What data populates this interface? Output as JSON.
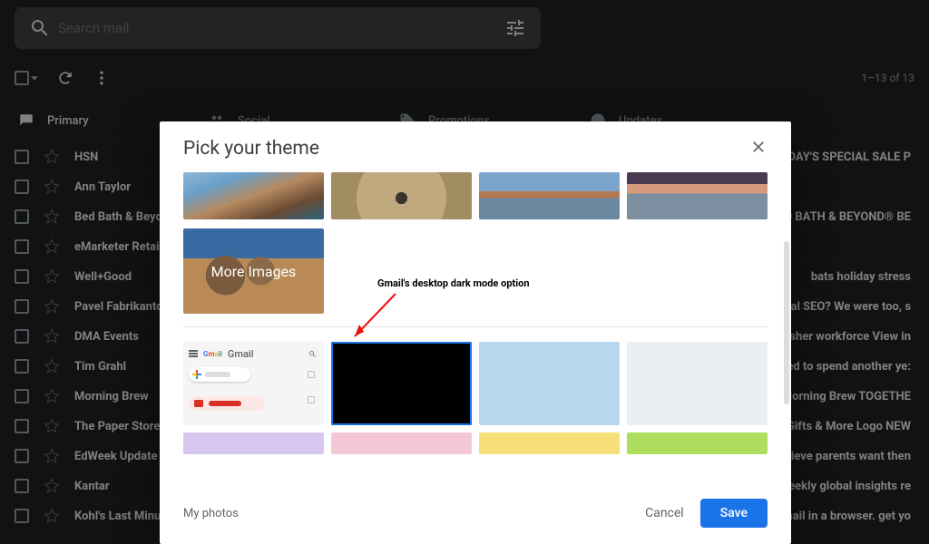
{
  "search": {
    "placeholder": "Search mail"
  },
  "toolbar": {
    "range": "1–13 of 13"
  },
  "tabs": {
    "primary": "Primary",
    "social": "Social",
    "promotions": "Promotions",
    "updates": "Updates"
  },
  "mail": [
    {
      "sender": "HSN",
      "snippet": "SN TODAY'S SPECIAL SALE P"
    },
    {
      "sender": "Ann Taylor",
      "snippet": ""
    },
    {
      "sender": "Bed Bath & Beyon",
      "snippet": "w BED BATH & BEYOND® BE"
    },
    {
      "sender": "eMarketer Retail E",
      "snippet": ""
    },
    {
      "sender": "Well+Good",
      "snippet": "bats holiday stress"
    },
    {
      "sender": "Pavel Fabrikantov",
      "snippet": "ct Local SEO? We were too, s"
    },
    {
      "sender": "DMA Events",
      "snippet": "s a fresher workforce View in"
    },
    {
      "sender": "Tim Grahl",
      "snippet": "OT need to spend another ye:"
    },
    {
      "sender": "Morning Brew",
      "snippet": "Shop Morning Brew TOGETHE"
    },
    {
      "sender": "The Paper Store",
      "snippet": "r Store Gifts & More Logo NEW"
    },
    {
      "sender": "EdWeek Update",
      "snippet": "ey believe parents want then"
    },
    {
      "sender": "Kantar",
      "snippet": "final weekly global insights re"
    },
    {
      "sender": "Kohl's Last Minute",
      "snippet": "this email in a browser. get yo"
    }
  ],
  "modal": {
    "title": "Pick your theme",
    "more_images": "More Images",
    "annotation": "Gmail's desktop dark mode option",
    "gmail_label": "Gmail",
    "my_photos": "My photos",
    "cancel": "Cancel",
    "save": "Save"
  },
  "theme_colors": {
    "dark": "#000000",
    "blue": "#b7d7ee",
    "gray": "#eceff1",
    "purple": "#d6c6f0",
    "pink": "#f3c7d6",
    "yellow": "#f7e07a",
    "green": "#aede5d"
  }
}
